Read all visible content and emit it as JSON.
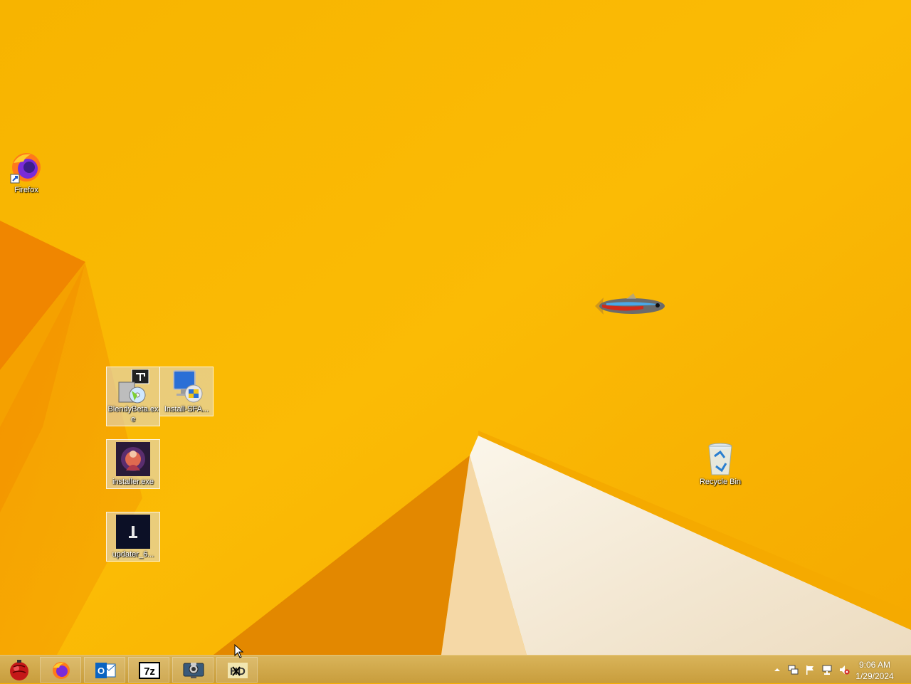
{
  "desktop": {
    "icons": [
      {
        "label": "Firefox",
        "icon": "firefox-shortcut-icon"
      },
      {
        "label": "BlendyBeta.exe",
        "icon": "installer-cd-icon"
      },
      {
        "label": "Install-SFA...",
        "icon": "setup-computer-icon"
      },
      {
        "label": "installer.exe",
        "icon": "installer-thumbnail-icon"
      },
      {
        "label": "updater_6...",
        "icon": "updater-thumbnail-icon"
      },
      {
        "label": "Recycle Bin",
        "icon": "recycle-bin-icon"
      }
    ]
  },
  "taskbar": {
    "start_icon": "start-ball-icon",
    "pinned": [
      "firefox",
      "outlook",
      "7-zip",
      "screen-capture",
      "hxd"
    ],
    "tray": {
      "icons": [
        "show-hidden-icons-arrow",
        "network-icon",
        "action-center-flag-icon",
        "connection-icon",
        "volume-muted-icon"
      ],
      "time": "9:06 AM",
      "date": "1/29/2024"
    }
  },
  "colors": {
    "wallpaper": "#f9b000",
    "taskbar": "#cda243",
    "accent_orange": "#f08c00",
    "cream": "#f3ead7"
  }
}
